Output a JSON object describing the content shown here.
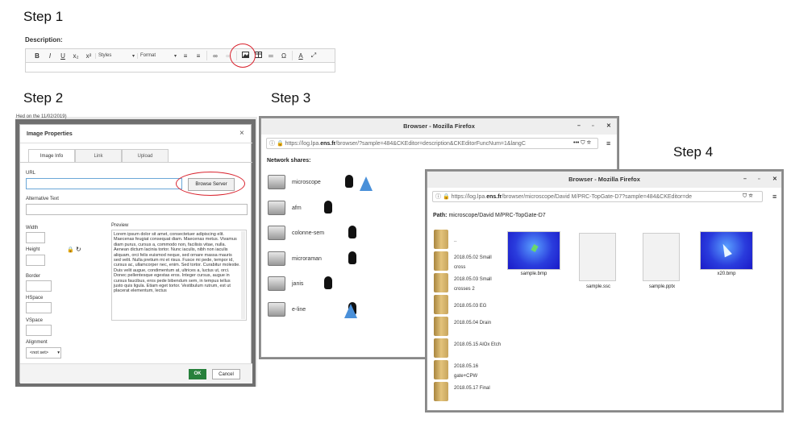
{
  "steps": {
    "s1": "Step 1",
    "s2": "Step 2",
    "s3": "Step 3",
    "s4": "Step 4"
  },
  "step1": {
    "description_label": "Description:",
    "toolbar": {
      "bold": "B",
      "italic": "I",
      "underline": "U",
      "subscript": "x₂",
      "superscript": "x²",
      "styles": "Styles",
      "format": "Format",
      "omega": "Ω",
      "font_color": "A"
    }
  },
  "step2": {
    "bg_text": "Hed on the 11/02/2019)",
    "title": "Image Properties",
    "close": "×",
    "tabs": [
      "Image Info",
      "Link",
      "Upload"
    ],
    "url_label": "URL",
    "browse_button": "Browse Server",
    "alt_label": "Alternative Text",
    "width_label": "Width",
    "height_label": "Height",
    "border_label": "Border",
    "hspace_label": "HSpace",
    "vspace_label": "VSpace",
    "alignment_label": "Alignment",
    "alignment_value": "<not set>",
    "preview_label": "Preview",
    "preview_text": "Lorem ipsum dolor sit amet, consectetuer adipiscing elit. Maecenas feugiat consequat diam. Maecenas metus. Vivamus diam purus, cursus a, commodo non, facilisis vitae, nulla. Aenean dictum lacinia tortor. Nunc iaculis, nibh non iaculis aliquam, orci felis euismod neque, sed ornare massa mauris sed velit. Nulla pretium mi et risus. Fusce mi pede, tempor id, cursus ac, ullamcorper nec, enim. Sed tortor. Curabitur molestie. Duis velit augue, condimentum at, ultrices a, luctus ut, orci. Donec pellentesque egestas eros. Integer cursus, augue in cursus faucibus, eros pede bibendum sem, in tempus tellus justo quis ligula. Etiam eget tortor. Vestibulum rutrum, est ut placerat elementum, lectus",
    "ok": "OK",
    "cancel": "Cancel"
  },
  "step3": {
    "title": "Browser - Mozilla Firefox",
    "url_pre": "https://log.lpa.",
    "url_bold": "ens.fr",
    "url_post": "/browser/?sample=484&CKEditor=description&CKEditorFuncNum=1&langC",
    "network_label": "Network shares:",
    "shares": [
      {
        "name": "microscope",
        "flask": true
      },
      {
        "name": "afm",
        "flask": false
      },
      {
        "name": "colonne-sem",
        "flask": false
      },
      {
        "name": "microraman",
        "flask": false
      },
      {
        "name": "janis",
        "flask": false
      },
      {
        "name": "e-line",
        "flask": true
      }
    ]
  },
  "step4": {
    "title": "Browser - Mozilla Firefox",
    "url_pre": "https://log.lpa.",
    "url_bold": "ens.fr",
    "url_post": "/browser/microscope/David M/PRC-TopGate-D7?sample=484&CKEditor=de",
    "path_label": "Path:",
    "path": "microscope/David M/PRC-TopGate-D7",
    "folders": [
      "..",
      "2018.05.02 Small cross",
      "2018.05.03 Small crosses 2",
      "2018.05.03 EG",
      "2018.05.04 Drain",
      "2018.05.15 AlOx Etch",
      "2018.05.16 gate+CPW",
      "2018.05.17 Final"
    ],
    "files": [
      "sample.bmp",
      "sample.ssc",
      "sample.pptx",
      "x20.bmp"
    ]
  },
  "colors": {
    "accent_red": "#d9232e",
    "ok_green": "#27803b",
    "ff_lock": "#2e9a2e"
  }
}
